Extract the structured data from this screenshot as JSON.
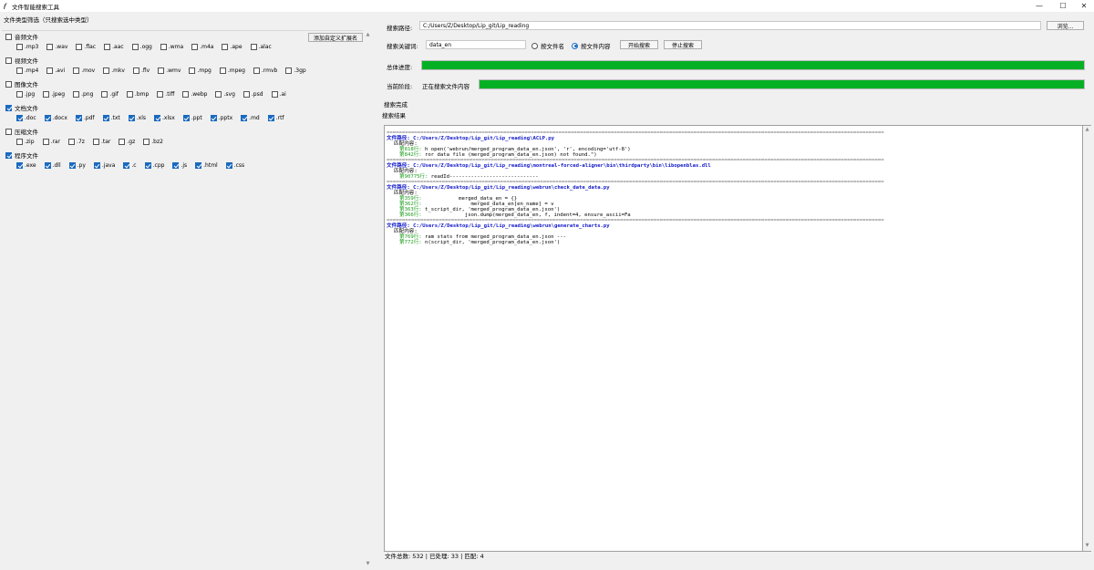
{
  "window": {
    "title": "文件智能搜索工具",
    "minimize": "—",
    "maximize": "☐",
    "close": "✕"
  },
  "filter": {
    "group_title": "文件类型筛选（只搜索选中类型）",
    "add_ext_label": "添加自定义扩展名",
    "categories": [
      {
        "label": "音频文件",
        "checked": false,
        "exts": [
          ".mp3",
          ".wav",
          ".flac",
          ".aac",
          ".ogg",
          ".wma",
          ".m4a",
          ".ape",
          ".alac"
        ]
      },
      {
        "label": "视频文件",
        "checked": false,
        "exts": [
          ".mp4",
          ".avi",
          ".mov",
          ".mkv",
          ".flv",
          ".wmv",
          ".mpg",
          ".mpeg",
          ".rmvb",
          ".3gp"
        ]
      },
      {
        "label": "图像文件",
        "checked": false,
        "exts": [
          ".jpg",
          ".jpeg",
          ".png",
          ".gif",
          ".bmp",
          ".tiff",
          ".webp",
          ".svg",
          ".psd",
          ".ai"
        ]
      },
      {
        "label": "文档文件",
        "checked": true,
        "exts": [
          ".doc",
          ".docx",
          ".pdf",
          ".txt",
          ".xls",
          ".xlsx",
          ".ppt",
          ".pptx",
          ".md",
          ".rtf"
        ]
      },
      {
        "label": "压缩文件",
        "checked": false,
        "exts": [
          ".zip",
          ".rar",
          ".7z",
          ".tar",
          ".gz",
          ".bz2"
        ]
      },
      {
        "label": "程序文件",
        "checked": true,
        "exts": [
          ".exe",
          ".dll",
          ".py",
          ".java",
          ".c",
          ".cpp",
          ".js",
          ".html",
          ".css"
        ]
      }
    ]
  },
  "search": {
    "path_label": "搜索路径:",
    "path_value": "C:/Users/Z/Desktop/Lip_git/Lip_reading",
    "browse_label": "浏览...",
    "keyword_label": "搜索关键词:",
    "keyword_value": "data_en",
    "radio_filename": "按文件名",
    "radio_content": "按文件内容",
    "selected_mode": "content",
    "start_label": "开始搜索",
    "stop_label": "停止搜索"
  },
  "progress": {
    "overall_label": "总体进度:",
    "overall_fraction": 1.0,
    "stage_label": "当前阶段:",
    "stage_text": "正在搜索文件内容",
    "stage_fraction": 1.0,
    "done_text": "搜索完成"
  },
  "results": {
    "title": "搜索结果",
    "separator": "==================================================================================================================================================================",
    "path_prefix": "文件路径: ",
    "match_label": "匹配内容:",
    "entries": [
      {
        "path": "C:/Users/Z/Desktop/Lip_git/Lip_reading\\ACLP.py",
        "lines": [
          {
            "num": "第818行:",
            "text": " h open('webrun/merged_program_data_en.json', 'r', encoding='utf-8')"
          },
          {
            "num": "第842行:",
            "text": " ror data file (merged_program_data_en.json) not found.\")"
          }
        ]
      },
      {
        "path": "C:/Users/Z/Desktop/Lip_git/Lip_reading\\montreal-forced-aligner\\bin\\thirdparty\\bin\\libopenblas.dll",
        "lines": [
          {
            "num": "第90775行:",
            "text": " readId-----------------------------"
          }
        ]
      },
      {
        "path": "C:/Users/Z/Desktop/Lip_git/Lip_reading\\webrun\\check_date_data.py",
        "lines": [
          {
            "num": "第359行:",
            "text": "            merged_data_en = {}"
          },
          {
            "num": "第362行:",
            "text": "                merged_data_en[en_name] = v"
          },
          {
            "num": "第363行:",
            "text": " t_script_dir, 'merged_program_data_en.json')"
          },
          {
            "num": "第366行:",
            "text": "              json.dump(merged_data_en, f, indent=4, ensure_ascii=Fa"
          }
        ]
      },
      {
        "path": "C:/Users/Z/Desktop/Lip_git/Lip_reading\\webrun\\generate_charts.py",
        "lines": [
          {
            "num": "第769行:",
            "text": " ram stats from merged_program_data_en.json ---"
          },
          {
            "num": "第772行:",
            "text": " n(script_dir, 'merged_program_data_en.json')"
          }
        ]
      }
    ]
  },
  "status": {
    "text": "文件总数: 532 | 已处理: 33 | 匹配: 4"
  }
}
